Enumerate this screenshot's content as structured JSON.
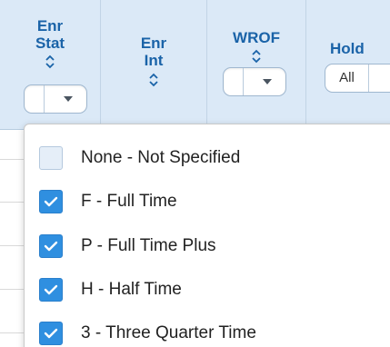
{
  "columns": [
    {
      "id": "enr-stat",
      "title_line1": "Enr",
      "title_line2": "Stat"
    },
    {
      "id": "enr-int",
      "title_line1": "Enr",
      "title_line2": "Int"
    },
    {
      "id": "wrof",
      "title_line1": "WROF"
    },
    {
      "id": "hold",
      "title_line1": "Hold",
      "filter_value": "All"
    }
  ],
  "dropdown": {
    "options": [
      {
        "label": "None - Not Specified",
        "checked": false
      },
      {
        "label": "F - Full Time",
        "checked": true
      },
      {
        "label": "P - Full Time Plus",
        "checked": true
      },
      {
        "label": "H - Half Time",
        "checked": true
      },
      {
        "label": "3 - Three Quarter Time",
        "checked": true
      }
    ]
  },
  "colors": {
    "header_bg": "#dbe9f7",
    "header_text": "#1a63a8",
    "checkbox_checked": "#2f8fe0",
    "checkbox_unchecked": "#e5eef8"
  }
}
